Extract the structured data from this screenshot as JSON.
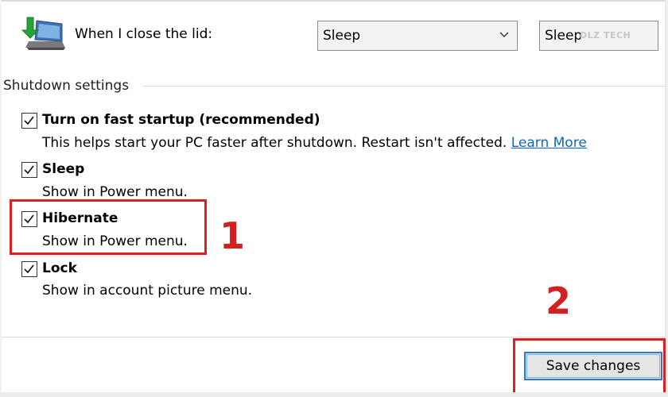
{
  "lid": {
    "label": "When I close the lid:",
    "battery_value": "Sleep",
    "plugged_value": "Sleep",
    "watermark": "DLZ TECH"
  },
  "shutdown": {
    "section_label": "Shutdown settings",
    "options": [
      {
        "title": "Turn on fast startup (recommended)",
        "desc": "This helps start your PC faster after shutdown. Restart isn't affected.",
        "link": "Learn More",
        "checked": true
      },
      {
        "title": "Sleep",
        "desc": "Show in Power menu.",
        "checked": true
      },
      {
        "title": "Hibernate",
        "desc": "Show in Power menu.",
        "checked": true
      },
      {
        "title": "Lock",
        "desc": "Show in account picture menu.",
        "checked": true
      }
    ]
  },
  "annotations": {
    "step1": "1",
    "step2": "2",
    "highlight_color": "#e02020"
  },
  "footer": {
    "save_label": "Save changes"
  },
  "icons": {
    "lid": "laptop-lid-icon",
    "dropdown": "chevron-down-icon",
    "check": "checkmark-icon"
  }
}
